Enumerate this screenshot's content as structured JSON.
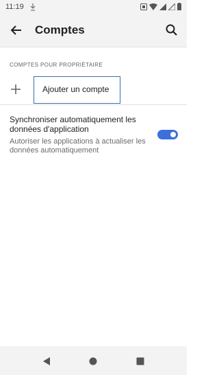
{
  "status_bar": {
    "time": "11:19",
    "notification_icon": "download-icon",
    "right_icons": [
      "app-notification-icon",
      "wifi-icon",
      "signal-icon",
      "signal-icon",
      "battery-icon"
    ]
  },
  "header": {
    "title": "Comptes",
    "back_icon": "arrow-back-icon",
    "search_icon": "search-icon"
  },
  "section": {
    "header": "COMPTES POUR PROPRIÉTAIRE",
    "add_account_label": "Ajouter un compte",
    "add_icon": "plus-icon"
  },
  "sync": {
    "title": "Synchroniser automatiquement les données d'application",
    "summary": "Autoriser les applications à actualiser les données automatiquement",
    "enabled": true,
    "accent_color": "#3d6ede"
  },
  "nav_bar": {
    "icons": [
      "nav-back-icon",
      "nav-home-icon",
      "nav-recent-icon"
    ]
  }
}
